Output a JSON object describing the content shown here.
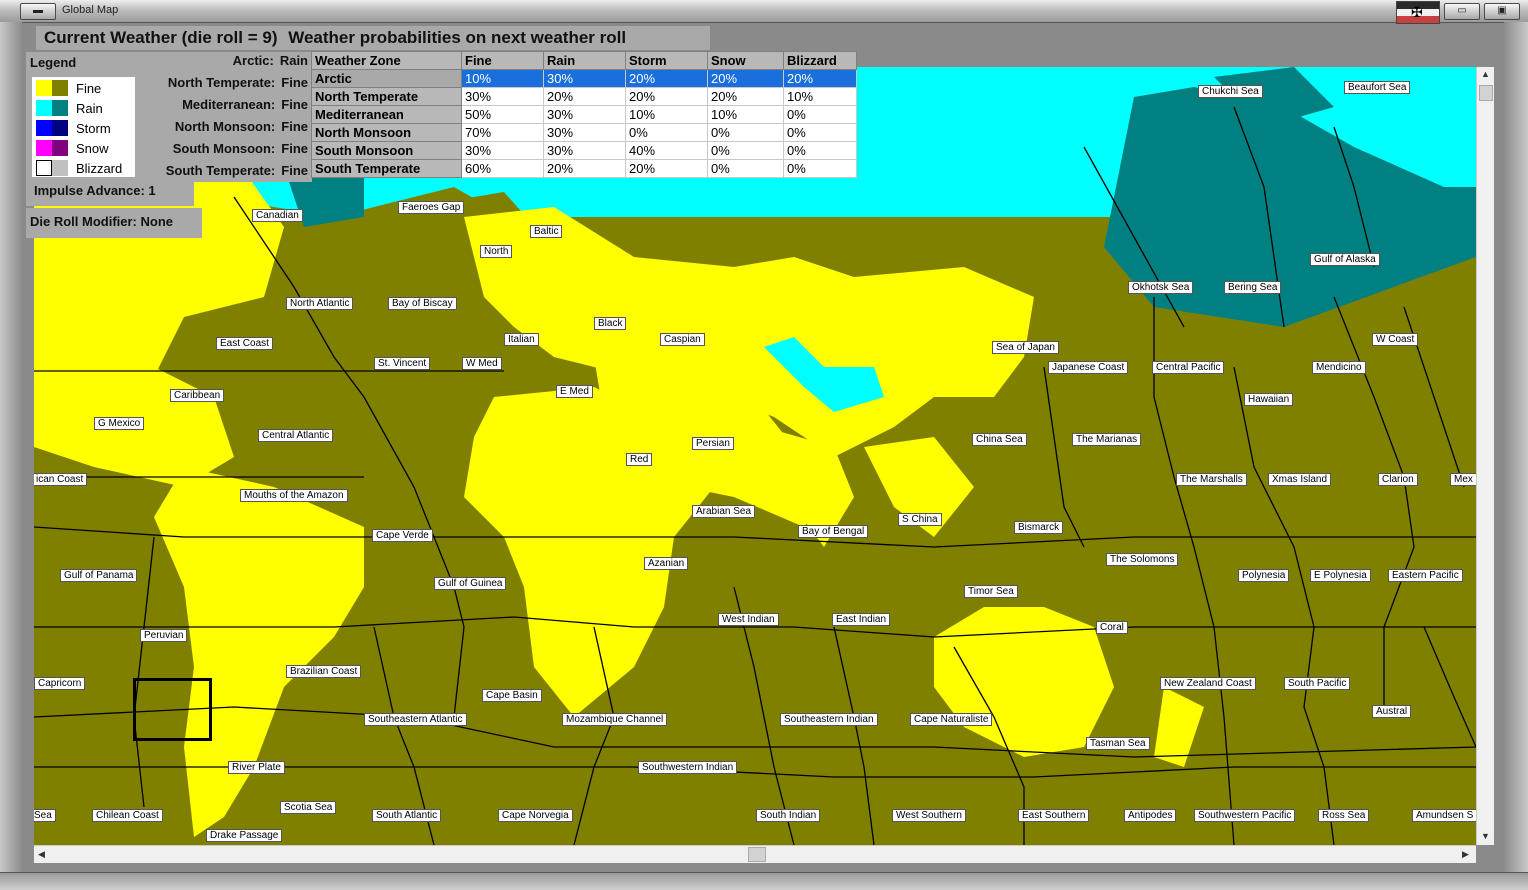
{
  "window": {
    "title": "Global Map"
  },
  "weather": {
    "title": "Current Weather (die roll = 9)",
    "probabilities_title": "Weather probabilities on next weather roll"
  },
  "legend": {
    "title": "Legend",
    "items": [
      {
        "label": "Fine",
        "colors": [
          "#ffff00",
          "#808000"
        ]
      },
      {
        "label": "Rain",
        "colors": [
          "#00ffff",
          "#008080"
        ]
      },
      {
        "label": "Storm",
        "colors": [
          "#0000ff",
          "#000080"
        ]
      },
      {
        "label": "Snow",
        "colors": [
          "#ff00ff",
          "#800080"
        ]
      },
      {
        "label": "Blizzard",
        "colors": [
          "#ffffff",
          "#c0c0c0"
        ]
      }
    ]
  },
  "zones_current": [
    {
      "name": "Arctic:",
      "value": "Rain"
    },
    {
      "name": "North Temperate:",
      "value": "Fine"
    },
    {
      "name": "Mediterranean:",
      "value": "Fine"
    },
    {
      "name": "North Monsoon:",
      "value": "Fine"
    },
    {
      "name": "South Monsoon:",
      "value": "Fine"
    },
    {
      "name": "South Temperate:",
      "value": "Fine"
    }
  ],
  "impulse": "Impulse Advance:  1",
  "modifier": "Die Roll Modifier:  None",
  "table": {
    "headers": [
      "Weather Zone",
      "Fine",
      "Rain",
      "Storm",
      "Snow",
      "Blizzard"
    ],
    "rows": [
      [
        "Arctic",
        "10%",
        "30%",
        "20%",
        "20%",
        "20%"
      ],
      [
        "North Temperate",
        "30%",
        "20%",
        "20%",
        "20%",
        "10%"
      ],
      [
        "Mediterranean",
        "50%",
        "30%",
        "10%",
        "10%",
        "0%"
      ],
      [
        "North Monsoon",
        "70%",
        "30%",
        "0%",
        "0%",
        "0%"
      ],
      [
        "South Monsoon",
        "30%",
        "30%",
        "40%",
        "0%",
        "0%"
      ],
      [
        "South Temperate",
        "60%",
        "20%",
        "20%",
        "0%",
        "0%"
      ]
    ],
    "selected_row": 0
  },
  "sea_areas": [
    "Chukchi Sea",
    "Beaufort Sea",
    "Canadian",
    "Faeroes Gap",
    "Baltic",
    "North",
    "Gulf of Alaska",
    "Okhotsk Sea",
    "Bering Sea",
    "North Atlantic",
    "Bay of Biscay",
    "Black",
    "Italian",
    "Caspian",
    "East Coast",
    "Sea of Japan",
    "W Coast",
    "St. Vincent",
    "W Med",
    "Japanese Coast",
    "Central Pacific",
    "Mendicino",
    "Caribbean",
    "E Med",
    "Hawaiian",
    "G Mexico",
    "Central Atlantic",
    "Persian",
    "China Sea",
    "The Marianas",
    "Red",
    "ican Coast",
    "The Marshalls",
    "Xmas Island",
    "Clarion",
    "Mex",
    "Mouths of the Amazon",
    "Arabian Sea",
    "S China",
    "Bismarck",
    "Bay of Bengal",
    "Cape Verde",
    "The Solomons",
    "Gulf of Panama",
    "Azanian",
    "Polynesia",
    "E Polynesia",
    "Eastern Pacific",
    "Gulf of Guinea",
    "Timor Sea",
    "Peruvian",
    "West Indian",
    "East Indian",
    "Coral",
    "Brazilian Coast",
    "Capricorn",
    "New Zealand Coast",
    "South Pacific",
    "Cape Basin",
    "Austral",
    "Southeastern Atlantic",
    "Mozambique Channel",
    "Southeastern Indian",
    "Cape Naturaliste",
    "Tasman Sea",
    "River Plate",
    "Southwestern Indian",
    "Scotia Sea",
    "Sea",
    "Chilean Coast",
    "South Atlantic",
    "Cape Norvegia",
    "South Indian",
    "West Southern",
    "East Southern",
    "Antipodes",
    "Southwestern Pacific",
    "Ross Sea",
    "Amundsen S",
    "Drake Passage"
  ]
}
